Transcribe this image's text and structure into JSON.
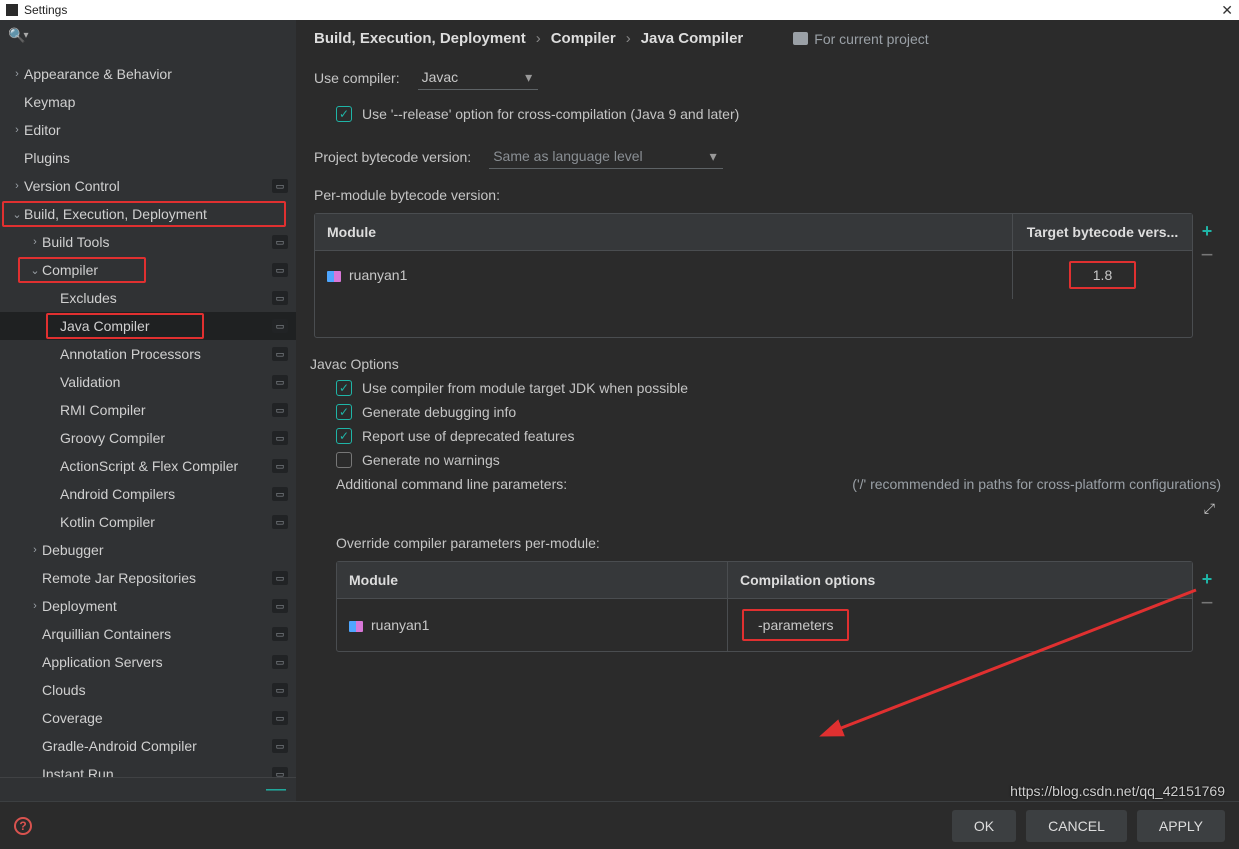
{
  "window": {
    "title": "Settings",
    "close": "✕"
  },
  "search": {
    "icon": "🔍"
  },
  "sidebar": [
    {
      "label": "Appearance & Behavior",
      "indent": 0,
      "chev": "›",
      "badge": false
    },
    {
      "label": "Keymap",
      "indent": 0,
      "chev": "",
      "badge": false
    },
    {
      "label": "Editor",
      "indent": 0,
      "chev": "›",
      "badge": false
    },
    {
      "label": "Plugins",
      "indent": 0,
      "chev": "",
      "badge": false
    },
    {
      "label": "Version Control",
      "indent": 0,
      "chev": "›",
      "badge": true
    },
    {
      "label": "Build, Execution, Deployment",
      "indent": 0,
      "chev": "⌄",
      "badge": false,
      "hl": "row"
    },
    {
      "label": "Build Tools",
      "indent": 1,
      "chev": "›",
      "badge": true
    },
    {
      "label": "Compiler",
      "indent": 1,
      "chev": "⌄",
      "badge": true,
      "hl": "tight"
    },
    {
      "label": "Excludes",
      "indent": 2,
      "chev": "",
      "badge": true
    },
    {
      "label": "Java Compiler",
      "indent": 2,
      "chev": "",
      "badge": true,
      "selected": true,
      "hl": "tighter"
    },
    {
      "label": "Annotation Processors",
      "indent": 2,
      "chev": "",
      "badge": true
    },
    {
      "label": "Validation",
      "indent": 2,
      "chev": "",
      "badge": true
    },
    {
      "label": "RMI Compiler",
      "indent": 2,
      "chev": "",
      "badge": true
    },
    {
      "label": "Groovy Compiler",
      "indent": 2,
      "chev": "",
      "badge": true
    },
    {
      "label": "ActionScript & Flex Compiler",
      "indent": 2,
      "chev": "",
      "badge": true
    },
    {
      "label": "Android Compilers",
      "indent": 2,
      "chev": "",
      "badge": true
    },
    {
      "label": "Kotlin Compiler",
      "indent": 2,
      "chev": "",
      "badge": true
    },
    {
      "label": "Debugger",
      "indent": 1,
      "chev": "›",
      "badge": false
    },
    {
      "label": "Remote Jar Repositories",
      "indent": 1,
      "chev": "",
      "badge": true
    },
    {
      "label": "Deployment",
      "indent": 1,
      "chev": "›",
      "badge": true
    },
    {
      "label": "Arquillian Containers",
      "indent": 1,
      "chev": "",
      "badge": true
    },
    {
      "label": "Application Servers",
      "indent": 1,
      "chev": "",
      "badge": true
    },
    {
      "label": "Clouds",
      "indent": 1,
      "chev": "",
      "badge": true
    },
    {
      "label": "Coverage",
      "indent": 1,
      "chev": "",
      "badge": true
    },
    {
      "label": "Gradle-Android Compiler",
      "indent": 1,
      "chev": "",
      "badge": true
    },
    {
      "label": "Instant Run",
      "indent": 1,
      "chev": "",
      "badge": true
    }
  ],
  "crumbs": [
    "Build, Execution, Deployment",
    "Compiler",
    "Java Compiler"
  ],
  "for_project": "For current project",
  "use_compiler_label": "Use compiler:",
  "use_compiler_value": "Javac",
  "release_option": "Use '--release' option for cross-compilation (Java 9 and later)",
  "pbv_label": "Project bytecode version:",
  "pbv_value": "Same as language level",
  "pmbv_label": "Per-module bytecode version:",
  "tbl1": {
    "h1": "Module",
    "h2": "Target bytecode vers...",
    "mod": "ruanyan1",
    "tgt": "1.8"
  },
  "javac_legend": "Javac Options",
  "opts": [
    {
      "label": "Use compiler from module target JDK when possible",
      "checked": true
    },
    {
      "label": "Generate debugging info",
      "checked": true
    },
    {
      "label": "Report use of deprecated features",
      "checked": true
    },
    {
      "label": "Generate no warnings",
      "checked": false
    }
  ],
  "add_params_label": "Additional command line parameters:",
  "add_params_hint": "('/' recommended in paths for cross-platform configurations)",
  "override_label": "Override compiler parameters per-module:",
  "tbl2": {
    "h1": "Module",
    "h2": "Compilation options",
    "mod": "ruanyan1",
    "opt": "-parameters"
  },
  "buttons": {
    "ok": "OK",
    "cancel": "CANCEL",
    "apply": "APPLY"
  },
  "watermark": "https://blog.csdn.net/qq_42151769"
}
